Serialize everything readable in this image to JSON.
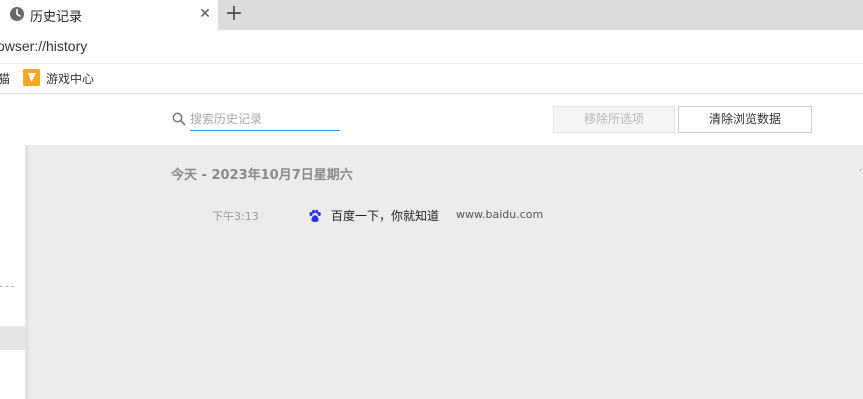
{
  "tab": {
    "title": "历史记录",
    "icon": "clock-icon",
    "close_glyph": "✕",
    "new_tab_glyph": "+"
  },
  "address_bar": {
    "url": "owser://history"
  },
  "bookmarks": {
    "partial_label": "猫",
    "items": [
      {
        "label": "游戏中心",
        "icon": "game-center-icon"
      }
    ]
  },
  "history": {
    "search": {
      "placeholder": "搜索历史记录",
      "value": ""
    },
    "remove_selected_label": "移除所选项",
    "clear_data_label": "清除浏览数据",
    "groups": [
      {
        "heading": "今天 - 2023年10月7日星期六",
        "entries": [
          {
            "time": "下午3:13",
            "title": "百度一下，你就知道",
            "domain": "www.baidu.com",
            "favicon": "baidu-paw-icon"
          }
        ]
      }
    ]
  },
  "colors": {
    "accent": "#4a90d9",
    "content_background": "#ececec",
    "tabstrip_background": "#dcdcdc",
    "bookmark_icon": "#f5a623",
    "baidu_blue": "#2932e1"
  }
}
